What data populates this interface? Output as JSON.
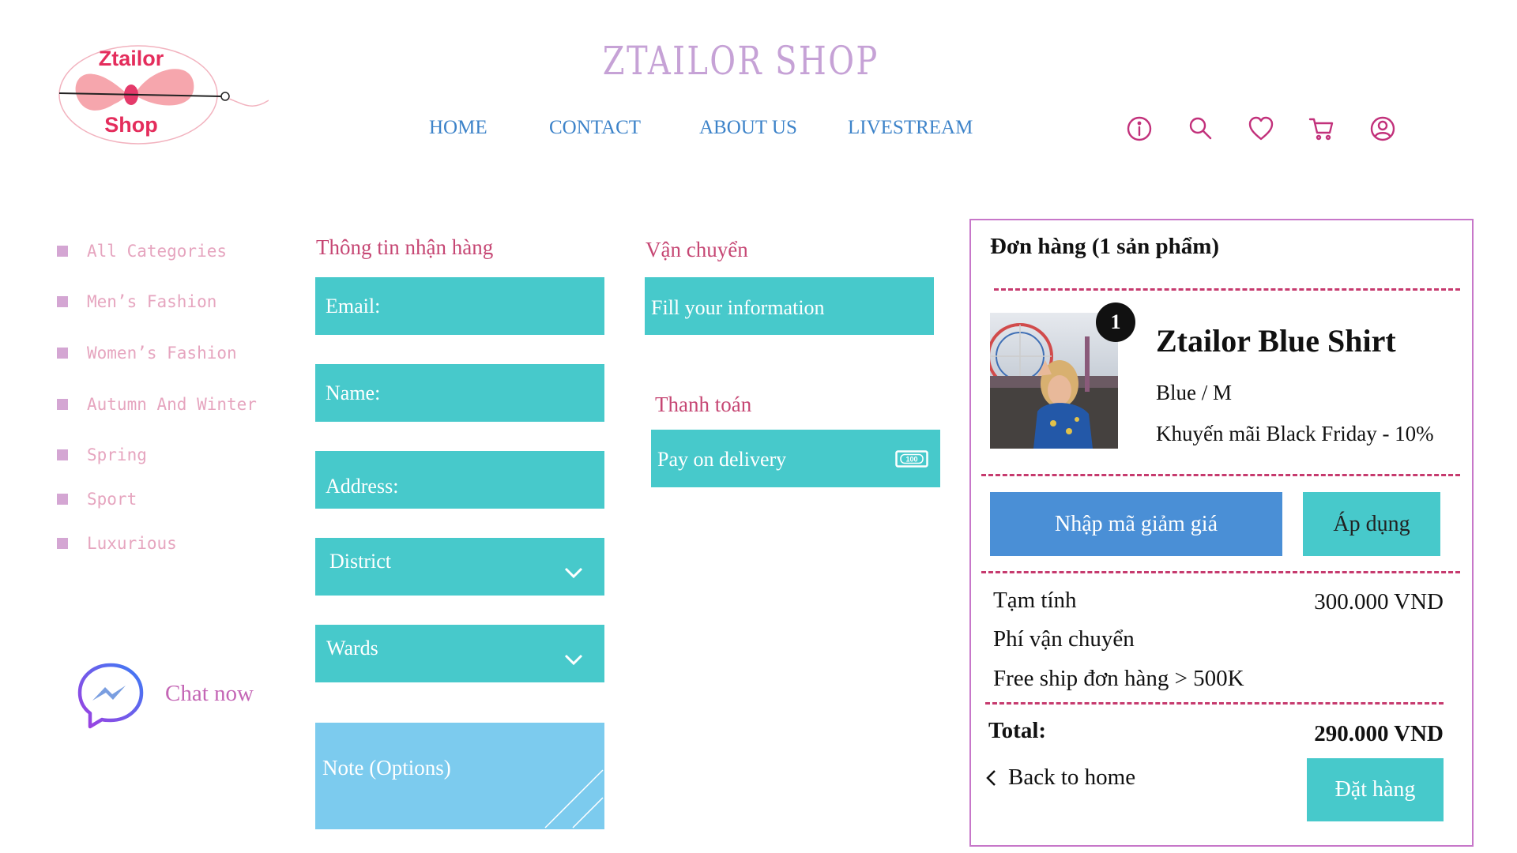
{
  "logo": {
    "line1": "Ztailor",
    "line2": "Shop"
  },
  "header": {
    "site_title": "ZTAILOR  SHOP",
    "nav": [
      "HOME",
      "CONTACT",
      "ABOUT US",
      "LIVESTREAM"
    ],
    "icons": [
      "info-icon",
      "search-icon",
      "heart-icon",
      "cart-icon",
      "user-icon"
    ]
  },
  "sidebar": {
    "categories": [
      "All Categories",
      "Men’s Fashion",
      "Women’s Fashion",
      "Autumn And Winter",
      "Spring",
      "Sport",
      "Luxurious"
    ],
    "chat_label": "Chat now"
  },
  "shipping_info": {
    "title": "Thông tin nhận hàng",
    "email_placeholder": "Email:",
    "name_placeholder": "Name:",
    "address_placeholder": "Address:",
    "district_label": "District",
    "wards_label": "Wards",
    "note_placeholder": "Note (Options)"
  },
  "delivery": {
    "title": "Vận chuyển",
    "placeholder": "Fill your information"
  },
  "payment": {
    "title": "Thanh toán",
    "method": "Pay on delivery",
    "money_icon_text": "100"
  },
  "order": {
    "title": "Đơn hàng (1 sản phẩm)",
    "item": {
      "quantity": "1",
      "name": "Ztailor Blue Shirt",
      "variant": "Blue / M",
      "promo": "Khuyến mãi Black Friday - 10%"
    },
    "coupon_button": "Nhập mã giảm giá",
    "apply_button": "Áp dụng",
    "subtotal_label": "Tạm tính",
    "subtotal_value": "300.000 VND",
    "shipping_label": "Phí vận chuyển",
    "freeship_note": "Free ship đơn hàng > 500K",
    "total_label": "Total:",
    "total_value": "290.000 VND",
    "back_label": "Back to home",
    "order_button": "Đặt hàng"
  },
  "colors": {
    "teal": "#47c9cb",
    "blue_button": "#4a8fd6",
    "light_blue": "#7ccbee",
    "nav_blue": "#3d83c9",
    "accent_pink": "#c2317b",
    "panel_border": "#c777c9"
  }
}
